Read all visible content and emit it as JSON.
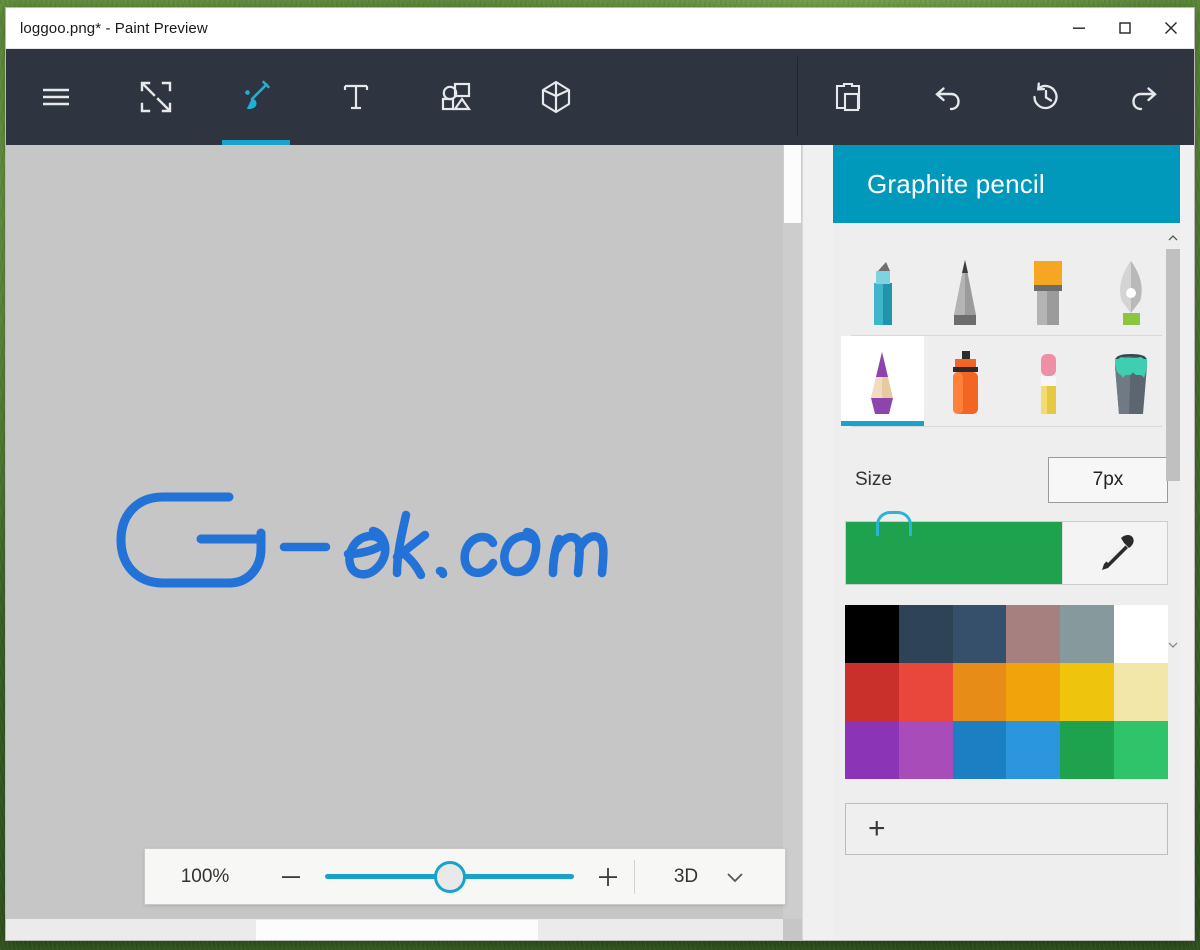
{
  "window": {
    "title": "loggoo.png* - Paint Preview",
    "controls": [
      {
        "name": "minimize",
        "glyph": "minimize-icon"
      },
      {
        "name": "maximize",
        "glyph": "maximize-icon"
      },
      {
        "name": "close",
        "glyph": "close-icon"
      }
    ]
  },
  "toolbar": {
    "background": "#2e3440",
    "accent": "#17a3cc",
    "left_tools": [
      {
        "name": "menu",
        "icon": "hamburger-menu-icon",
        "active": false
      },
      {
        "name": "crop-resize",
        "icon": "expand-arrows-icon",
        "active": false
      },
      {
        "name": "brushes",
        "icon": "paintbrush-icon",
        "active": true
      },
      {
        "name": "text",
        "icon": "text-t-icon",
        "active": false
      },
      {
        "name": "stickers-shapes",
        "icon": "shapes-icon",
        "active": false
      },
      {
        "name": "3d-shapes",
        "icon": "cube-3d-icon",
        "active": false
      }
    ],
    "right_tools": [
      {
        "name": "clipboard",
        "icon": "clipboard-icon"
      },
      {
        "name": "undo",
        "icon": "undo-arrow-icon"
      },
      {
        "name": "history",
        "icon": "history-clock-icon"
      },
      {
        "name": "redo",
        "icon": "redo-arrow-icon"
      }
    ]
  },
  "canvas": {
    "background": "#c6c6c6",
    "artwork_text": "G-ek.com",
    "artwork_color": "#2272d8"
  },
  "zoombar": {
    "zoom_percent": "100%",
    "minus_label": "minus-icon",
    "plus_label": "plus-icon",
    "slider_value": 50,
    "view_mode": "3D",
    "chevron": "chevron-down-icon"
  },
  "panel": {
    "header_title": "Graphite pencil",
    "header_color": "#0099bc",
    "brushes": [
      {
        "name": "marker",
        "label": "Marker",
        "selected": false
      },
      {
        "name": "pencil",
        "label": "Pencil",
        "selected": false
      },
      {
        "name": "calligraphy-brush",
        "label": "Calligraphy brush",
        "selected": false
      },
      {
        "name": "calligraphy-pen",
        "label": "Calligraphy pen",
        "selected": false
      },
      {
        "name": "graphite-pencil",
        "label": "Graphite pencil",
        "selected": true
      },
      {
        "name": "spray-can",
        "label": "Spray can",
        "selected": false
      },
      {
        "name": "eraser",
        "label": "Eraser",
        "selected": false
      },
      {
        "name": "fill-bucket",
        "label": "Fill with color",
        "selected": false
      }
    ],
    "size": {
      "label": "Size",
      "value": "7px"
    },
    "current_color": "#1fa24e",
    "eyedropper_icon": "eyedropper-icon",
    "palette_rows": [
      [
        "#000000",
        "#2f4356",
        "#36506b",
        "#a5807f",
        "#86999c",
        "#ffffff"
      ],
      [
        "#c9302c",
        "#e9463c",
        "#e88c18",
        "#f0a30a",
        "#efc40d",
        "#f2e6a9"
      ],
      [
        "#8b34b5",
        "#a74cb8",
        "#1c7fc4",
        "#2b95dd",
        "#1fa24e",
        "#2fc46a"
      ]
    ],
    "add_color": {
      "icon": "plus-icon",
      "label": "+"
    }
  }
}
